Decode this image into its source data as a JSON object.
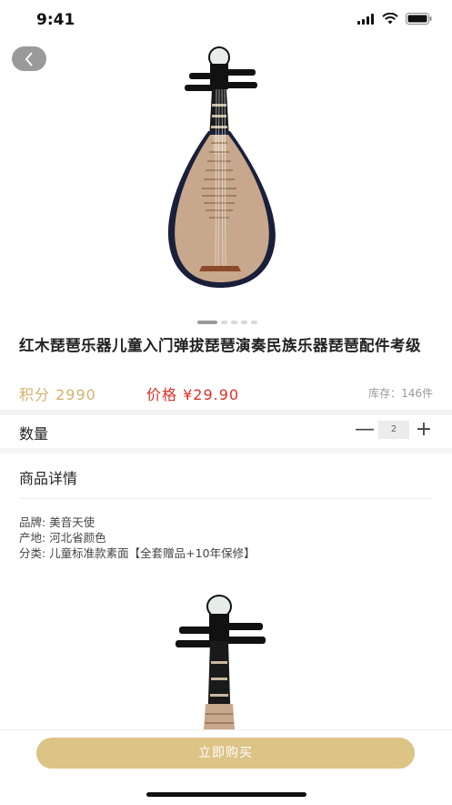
{
  "status": {
    "time": "9:41"
  },
  "product": {
    "title": "红木琵琶乐器儿童入门弹拔琵琶演奏民族乐器琵琶配件考级",
    "points": "积分 2990",
    "price": "价格 ¥29.90",
    "stock": "库存：146件"
  },
  "quantity": {
    "label": "数量",
    "value": "2",
    "minus": "—",
    "plus": "+"
  },
  "details": {
    "title": "商品详情",
    "specs": [
      "品牌: 美音天使",
      "产地: 河北省颜色",
      "分类: 儿童标准款素面【全套赠品+10年保修】"
    ]
  },
  "carousel": {
    "count": 5,
    "active": 0
  },
  "footer": {
    "buy_label": "立即购买"
  },
  "colors": {
    "accent": "#dcc386",
    "price_red": "#e02e24",
    "points_gold": "#d4b26e"
  }
}
